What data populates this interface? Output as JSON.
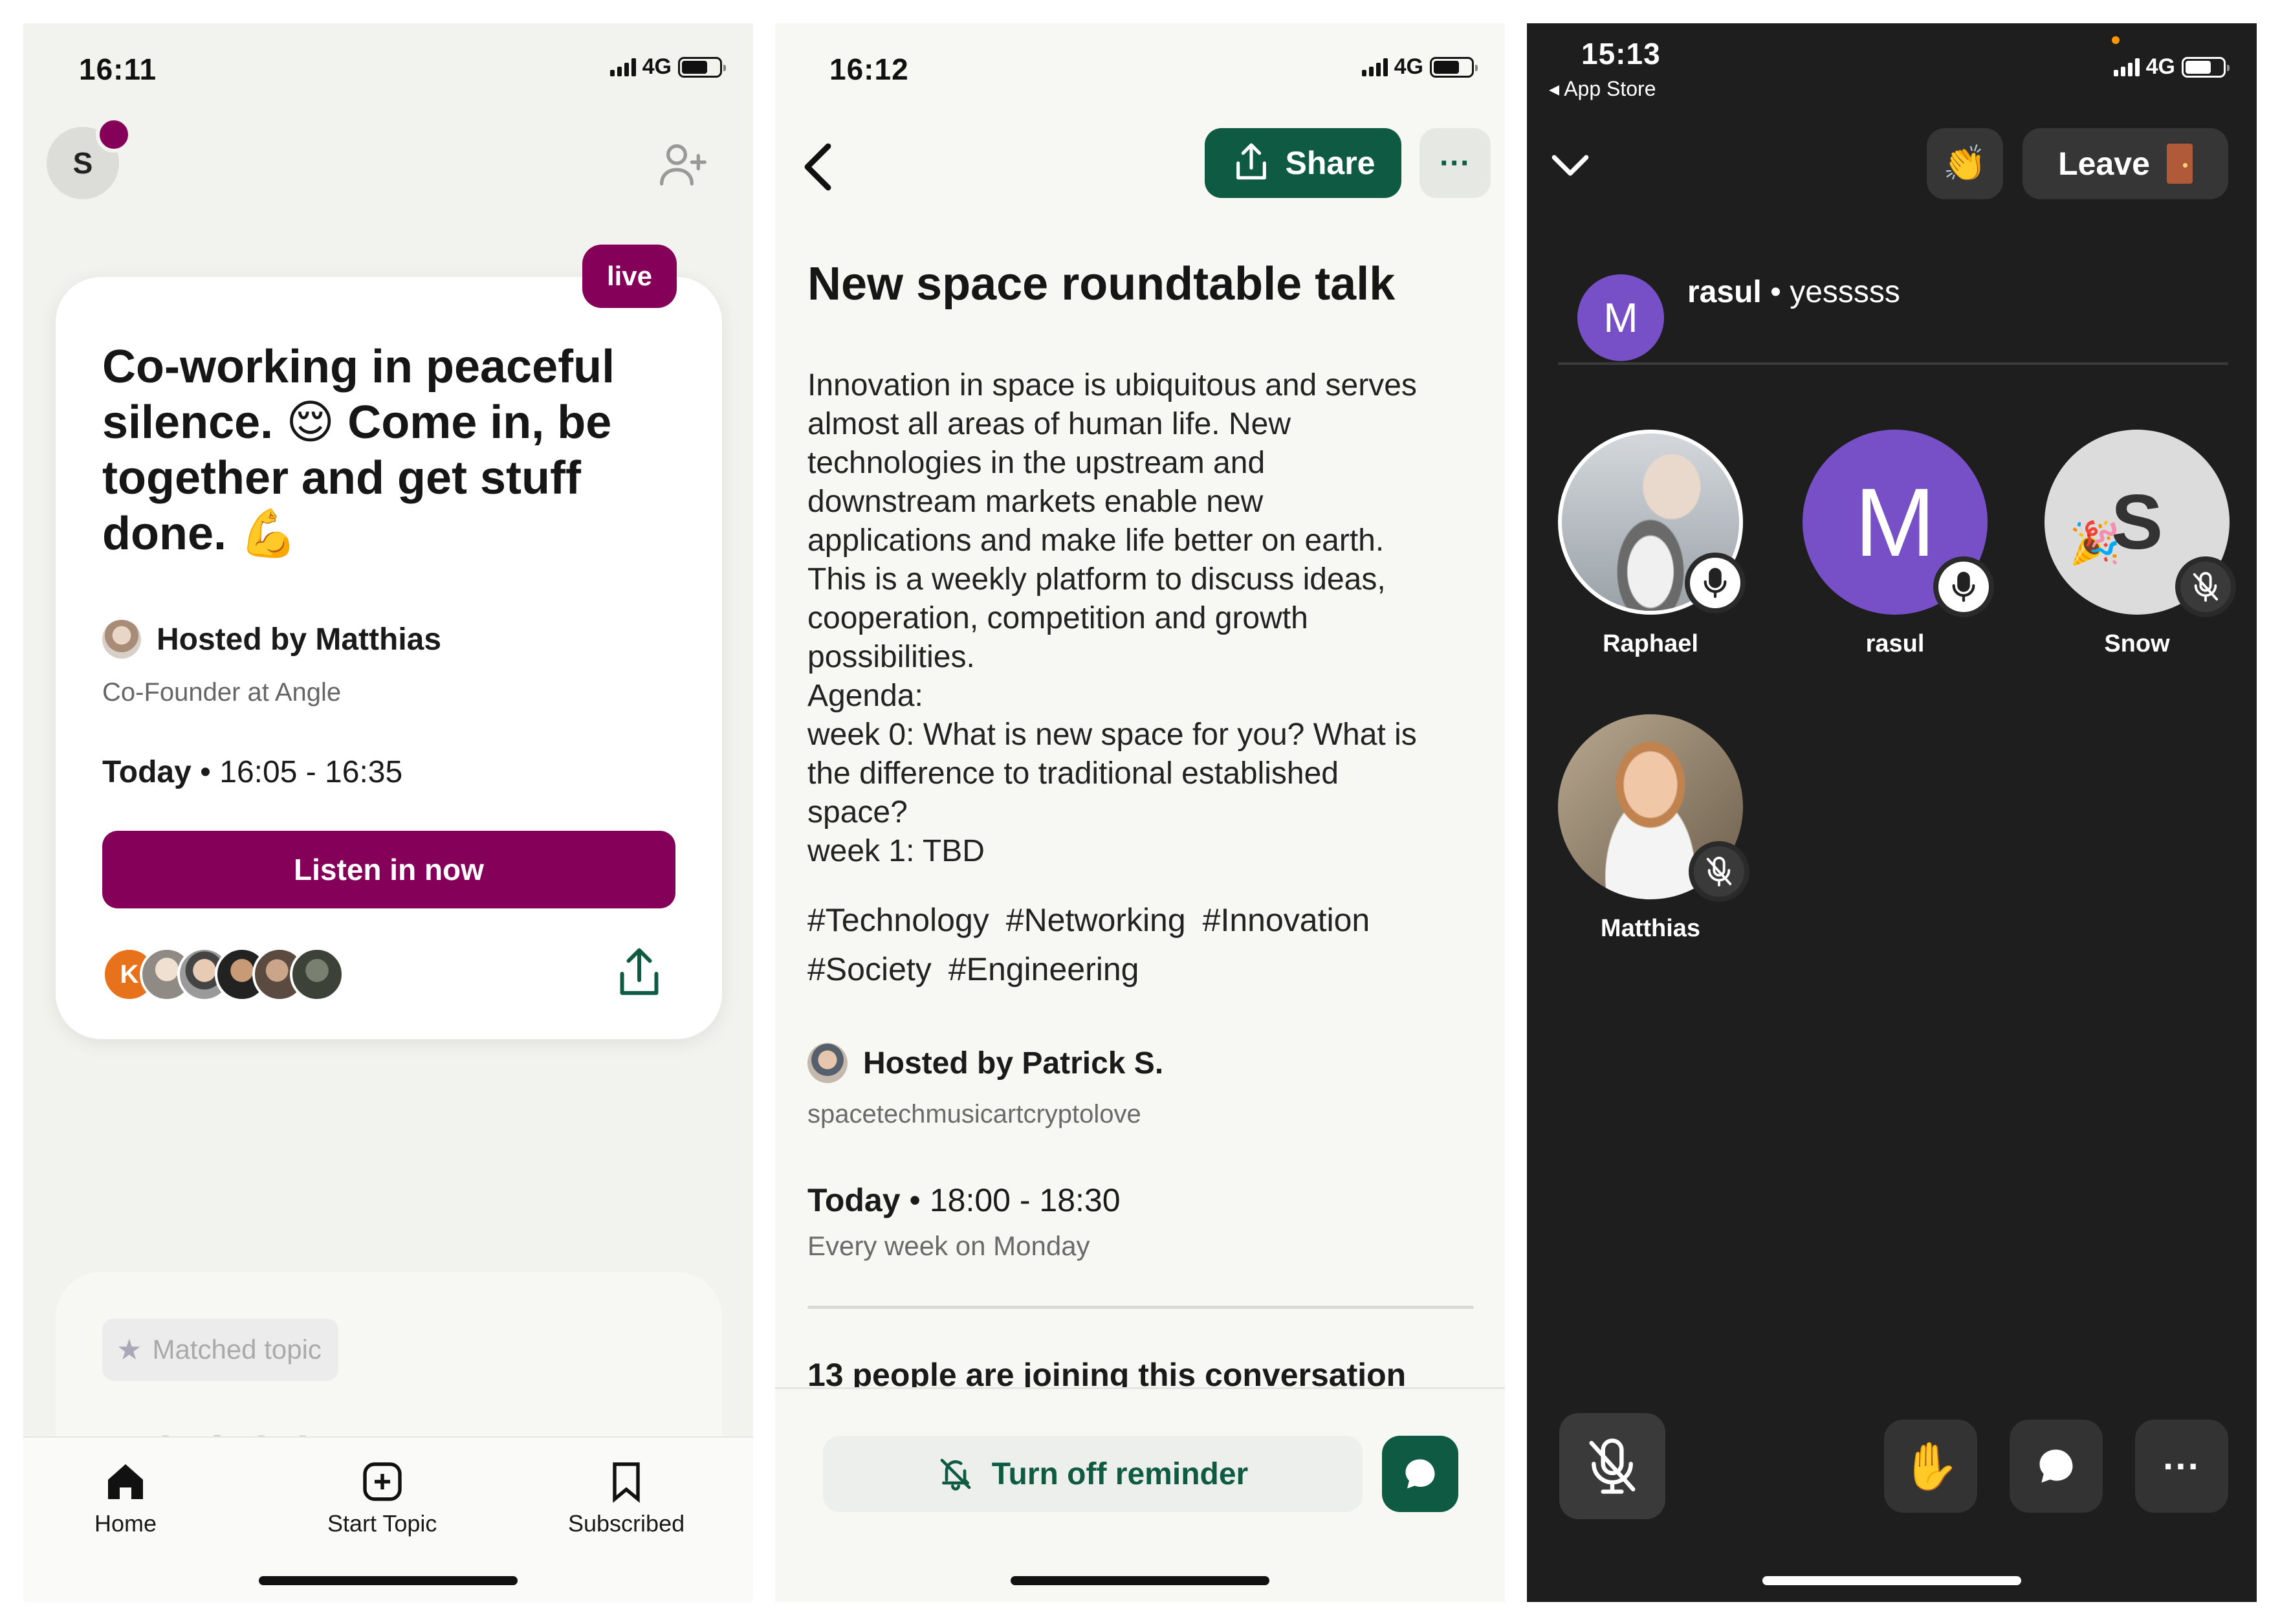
{
  "screen1": {
    "status": {
      "time": "16:11",
      "network": "4G"
    },
    "avatar_letter": "S",
    "live_label": "live",
    "card": {
      "title": "Co-working in peaceful silence. 😌 Come in, be together and get stuff done. 💪",
      "host": "Hosted by Matthias",
      "host_role": "Co-Founder at Angle",
      "day": "Today",
      "time_range": "16:05 - 16:35",
      "listen_label": "Listen in now",
      "first_listener_initial": "K"
    },
    "next_card": {
      "matched_label": "Matched topic",
      "title": "Dzień dobry!"
    },
    "tabs": [
      {
        "label": "Home",
        "icon": "home-icon"
      },
      {
        "label": "Start Topic",
        "icon": "plus-square-icon"
      },
      {
        "label": "Subscribed",
        "icon": "bookmark-icon"
      }
    ]
  },
  "screen2": {
    "status": {
      "time": "16:12",
      "network": "4G"
    },
    "share_label": "Share",
    "more_label": "···",
    "title": "New space roundtable talk",
    "description": "Innovation in space is ubiquitous and serves\nalmost all areas of human life. New\ntechnologies in the upstream and\ndownstream markets enable new\napplications and make life better on earth.\nThis is a weekly platform to discuss ideas,\ncooperation, competition and growth\npossibilities.\nAgenda:\nweek 0: What is new space for you? What is\nthe difference to traditional established\nspace?\nweek 1: TBD",
    "tags": [
      "#Technology",
      "#Networking",
      "#Innovation",
      "#Society",
      "#Engineering"
    ],
    "host": "Hosted by Patrick S.",
    "host_role": "spacetechmusicartcryptolove",
    "day": "Today",
    "time_range": "18:00 - 18:30",
    "recurrence": "Every week on Monday",
    "joining": "13 people are joining this conversation",
    "reminder_label": "Turn off reminder"
  },
  "screen3": {
    "status": {
      "time": "15:13",
      "network": "4G",
      "back_app": "◂ App Store"
    },
    "leave_label": "Leave",
    "clap_emoji": "👏",
    "message": {
      "avatar": "M",
      "author": "rasul",
      "separator": "•",
      "text": "yesssss"
    },
    "speakers": [
      {
        "name": "Raphael",
        "muted": false,
        "letter": ""
      },
      {
        "name": "rasul",
        "muted": false,
        "letter": "M"
      },
      {
        "name": "Snow",
        "muted": true,
        "letter": "S"
      },
      {
        "name": "Matthias",
        "muted": true,
        "letter": ""
      }
    ],
    "raise_hand_emoji": "✋",
    "more_label": "···"
  },
  "colors": {
    "brand_purple": "#850058",
    "brand_green": "#0f5a43",
    "dark_bg": "#1e1e1e",
    "rasul_purple": "#7750c7"
  }
}
